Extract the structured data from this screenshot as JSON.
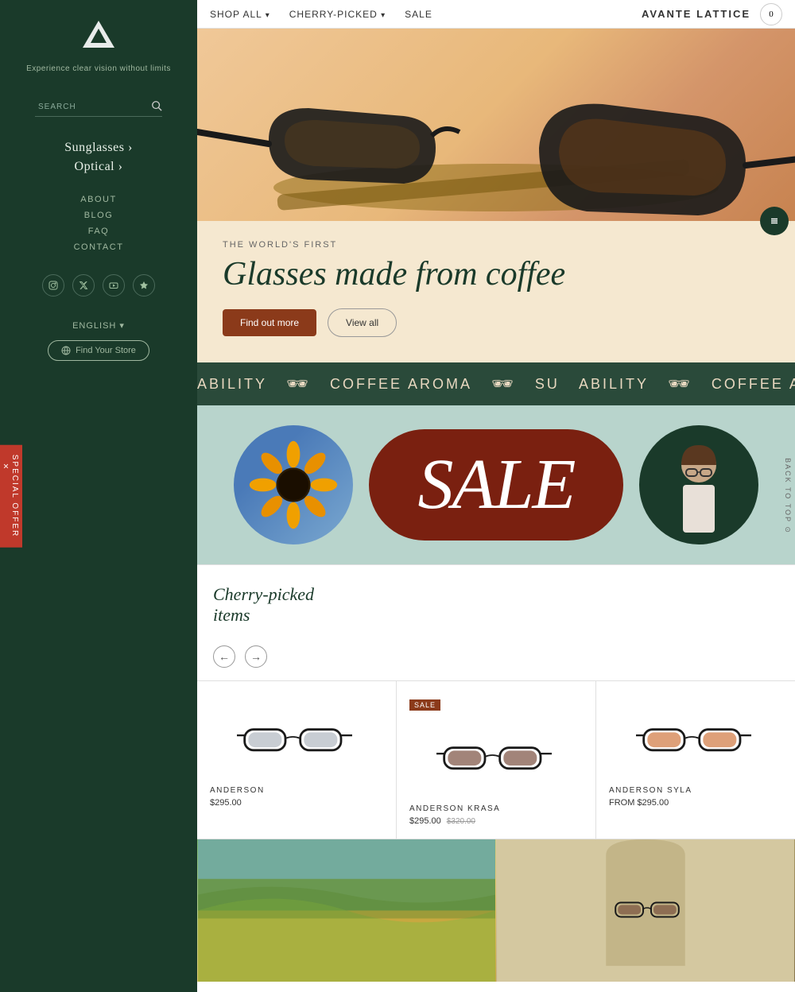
{
  "sidebar": {
    "logo_text": "▲",
    "tagline": "Experience clear vision without limits",
    "search_placeholder": "SEARCH",
    "nav_main": [
      {
        "label": "Sunglasses",
        "href": "#"
      },
      {
        "label": "Optical",
        "href": "#"
      }
    ],
    "nav_secondary": [
      {
        "label": "ABOUT",
        "href": "#"
      },
      {
        "label": "BLOG",
        "href": "#"
      },
      {
        "label": "FAQ",
        "href": "#"
      },
      {
        "label": "CONTACT",
        "href": "#"
      }
    ],
    "social": [
      "instagram",
      "twitter",
      "youtube",
      "trustpilot"
    ],
    "language": "ENGLISH",
    "find_store_label": "Find Your Store"
  },
  "topnav": {
    "links": [
      {
        "label": "SHOP ALL",
        "has_arrow": true
      },
      {
        "label": "CHERRY-PICKED",
        "has_arrow": true
      },
      {
        "label": "SALE",
        "has_arrow": false
      }
    ],
    "brand": "AVANTE LATTICE",
    "cart_count": "0"
  },
  "hero": {
    "subtitle": "THE WORLD'S FIRST",
    "title": "Glasses made from coffee",
    "btn_primary": "Find out more",
    "btn_secondary": "View all"
  },
  "marquee": {
    "items": [
      "ABILITY",
      "☕",
      "COFFEE AROMA",
      "☕",
      "SU",
      "ABILITY",
      "☕",
      "COFFEE AROMA",
      "☕",
      "SU"
    ]
  },
  "sale_banner": {
    "text": "SALE"
  },
  "cherry": {
    "title": "Cherry-picked\nitems",
    "products": [
      {
        "name": "ANDERSON",
        "price": "$295.00",
        "sale": false,
        "lens_color": "#b0b8c0"
      },
      {
        "name": "ANDERSON KRASA",
        "price": "$295.00",
        "price_old": "$320.00",
        "sale": true,
        "lens_color": "#7a5040"
      },
      {
        "name": "ANDERSON SYLA",
        "price": "FROM $295.00",
        "sale": false,
        "lens_color": "#d07840"
      }
    ]
  },
  "special_offer": {
    "label": "SPECIAL OFFER",
    "close": "×"
  },
  "back_to_top": "BACK TO TOP ⊙"
}
